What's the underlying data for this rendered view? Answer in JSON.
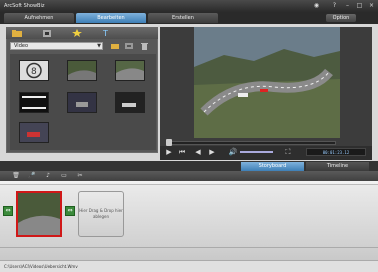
{
  "window": {
    "title": "ArcSoft ShowBiz",
    "icons": [
      "logo-icon",
      "help-icon",
      "minimize-icon",
      "maximize-icon",
      "close-icon"
    ]
  },
  "tabs": [
    {
      "label": "Aufnehmen"
    },
    {
      "label": "Bearbeiten",
      "active": true
    },
    {
      "label": "Erstellen"
    }
  ],
  "option_label": "Option",
  "library": {
    "source": "Video",
    "tab_icons": [
      "folder-icon",
      "film-icon",
      "star-effects-icon",
      "text-icon"
    ],
    "media": [
      "countdown-clip",
      "race-clip-1",
      "race-clip-2",
      "filmstrip-clip-1",
      "car-clip",
      "car-clip-2",
      "red-car-clip"
    ]
  },
  "player": {
    "timecode": "00:01:23.12",
    "controls": [
      "play-icon",
      "rewind-icon",
      "step-back-icon",
      "step-forward-icon",
      "volume-icon",
      "fullscreen-icon"
    ]
  },
  "view_tabs": [
    {
      "label": "Storyboard",
      "active": true
    },
    {
      "label": "Timeline"
    }
  ],
  "storyboard": {
    "drop_hint": "Hier Drag & Drop hier ablegen"
  },
  "status": {
    "path": "C:\\Users\\ACI\\Videos\\Uebersicht.Wmv"
  },
  "colors": {
    "accent": "#3e7fb6",
    "selected_clip": "#d01818",
    "transition": "#3b8a3b"
  }
}
